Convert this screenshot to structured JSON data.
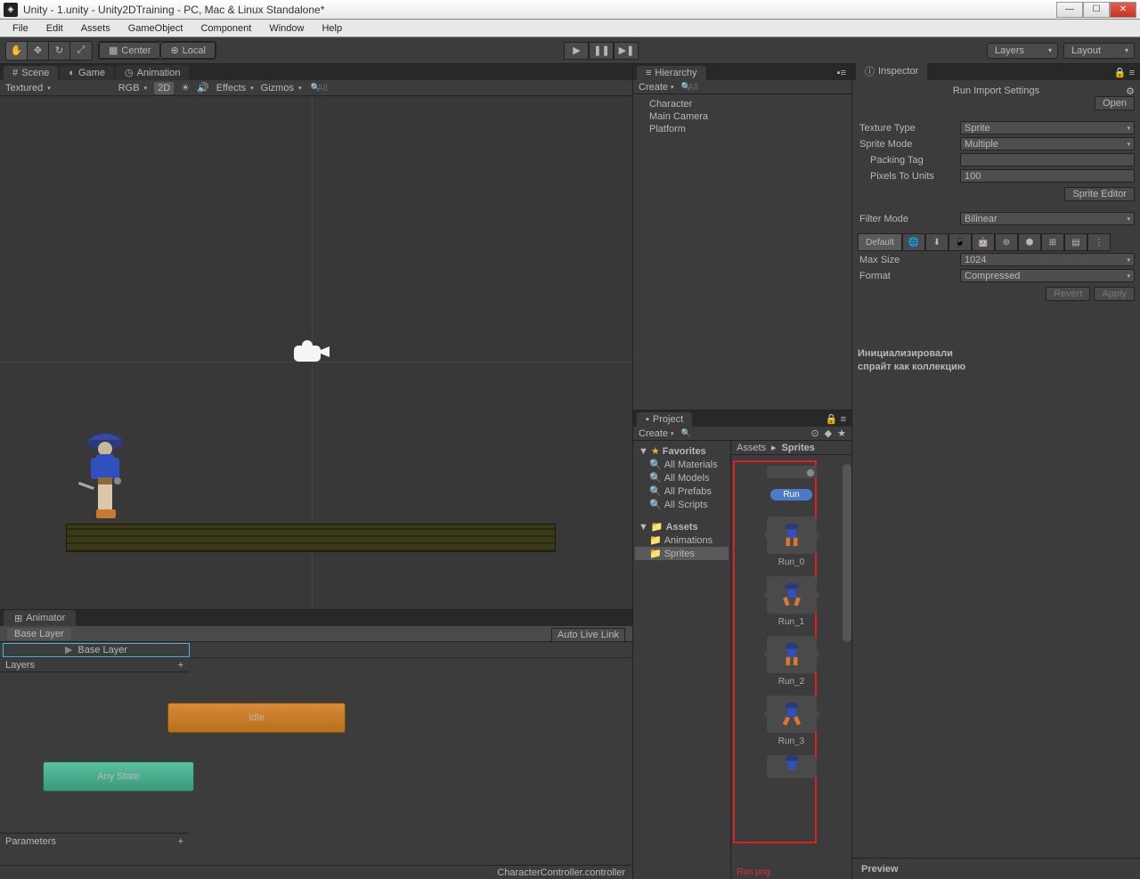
{
  "window": {
    "title": "Unity - 1.unity - Unity2DTraining - PC, Mac & Linux Standalone*"
  },
  "menu": [
    "File",
    "Edit",
    "Assets",
    "GameObject",
    "Component",
    "Window",
    "Help"
  ],
  "toolbar": {
    "center": "Center",
    "local": "Local",
    "layers": "Layers",
    "layout": "Layout"
  },
  "tabs": {
    "scene": "Scene",
    "game": "Game",
    "animation": "Animation"
  },
  "sceneToolbar": {
    "textured": "Textured",
    "rgb": "RGB",
    "twod": "2D",
    "effects": "Effects",
    "gizmos": "Gizmos",
    "search": "All"
  },
  "hierarchy": {
    "title": "Hierarchy",
    "create": "Create",
    "search": "All",
    "items": [
      "Character",
      "Main Camera",
      "Platform"
    ]
  },
  "project": {
    "title": "Project",
    "create": "Create",
    "favorites": "Favorites",
    "favItems": [
      "All Materials",
      "All Models",
      "All Prefabs",
      "All Scripts"
    ],
    "assets": "Assets",
    "folders": [
      "Animations",
      "Sprites"
    ],
    "breadcrumb": [
      "Assets",
      "Sprites"
    ],
    "runLabel": "Run",
    "sprites": [
      "Run_0",
      "Run_1",
      "Run_2",
      "Run_3"
    ],
    "cutoff": "Run.png"
  },
  "inspector": {
    "title": "Inspector",
    "heading": "Run Import Settings",
    "open": "Open",
    "textureType": {
      "label": "Texture Type",
      "value": "Sprite"
    },
    "spriteMode": {
      "label": "Sprite Mode",
      "value": "Multiple"
    },
    "packingTag": {
      "label": "Packing Tag",
      "value": ""
    },
    "pixelsToUnits": {
      "label": "Pixels To Units",
      "value": "100"
    },
    "spriteEditor": "Sprite Editor",
    "filterMode": {
      "label": "Filter Mode",
      "value": "Bilinear"
    },
    "default": "Default",
    "maxSize": {
      "label": "Max Size",
      "value": "1024"
    },
    "format": {
      "label": "Format",
      "value": "Compressed"
    },
    "revert": "Revert",
    "apply": "Apply",
    "preview": "Preview"
  },
  "animator": {
    "title": "Animator",
    "baseLayer": "Base Layer",
    "autoLive": "Auto Live Link",
    "layers": "Layers",
    "idle": "Idle",
    "anyState": "Any State",
    "parameters": "Parameters",
    "footer": "CharacterController.controller"
  },
  "annotation": {
    "line1": "Инициализировали",
    "line2": "спрайт как коллекцию"
  }
}
